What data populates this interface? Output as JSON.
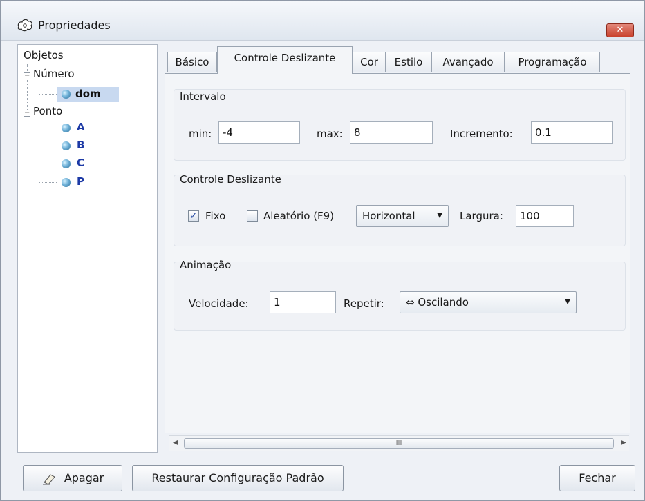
{
  "window": {
    "title": "Propriedades",
    "close_symbol": "✕"
  },
  "tree": {
    "root_label": "Objetos",
    "groups": [
      {
        "label": "Número",
        "items": [
          "dom"
        ]
      },
      {
        "label": "Ponto",
        "items": [
          "A",
          "B",
          "C",
          "P"
        ]
      }
    ],
    "selected_item": "dom"
  },
  "tabs": [
    "Básico",
    "Controle Deslizante",
    "Cor",
    "Estilo",
    "Avançado",
    "Programação"
  ],
  "active_tab": "Controle Deslizante",
  "intervalo": {
    "title": "Intervalo",
    "min_label": "min:",
    "min_value": "-4",
    "max_label": "max:",
    "max_value": "8",
    "incremento_label": "Incremento:",
    "incremento_value": "0.1"
  },
  "controle": {
    "title": "Controle Deslizante",
    "fixo_label": "Fixo",
    "fixo_checked": true,
    "aleatorio_label": "Aleatório (F9)",
    "aleatorio_checked": false,
    "orientation_value": "Horizontal",
    "largura_label": "Largura:",
    "largura_value": "100"
  },
  "animacao": {
    "title": "Animação",
    "velocidade_label": "Velocidade:",
    "velocidade_value": "1",
    "repetir_label": "Repetir:",
    "repetir_value": "⇔ Oscilando"
  },
  "scrollbar": {
    "thumb_grip": "III"
  },
  "buttons": {
    "apagar": "Apagar",
    "restaurar": "Restaurar Configuração Padrão",
    "fechar": "Fechar"
  }
}
